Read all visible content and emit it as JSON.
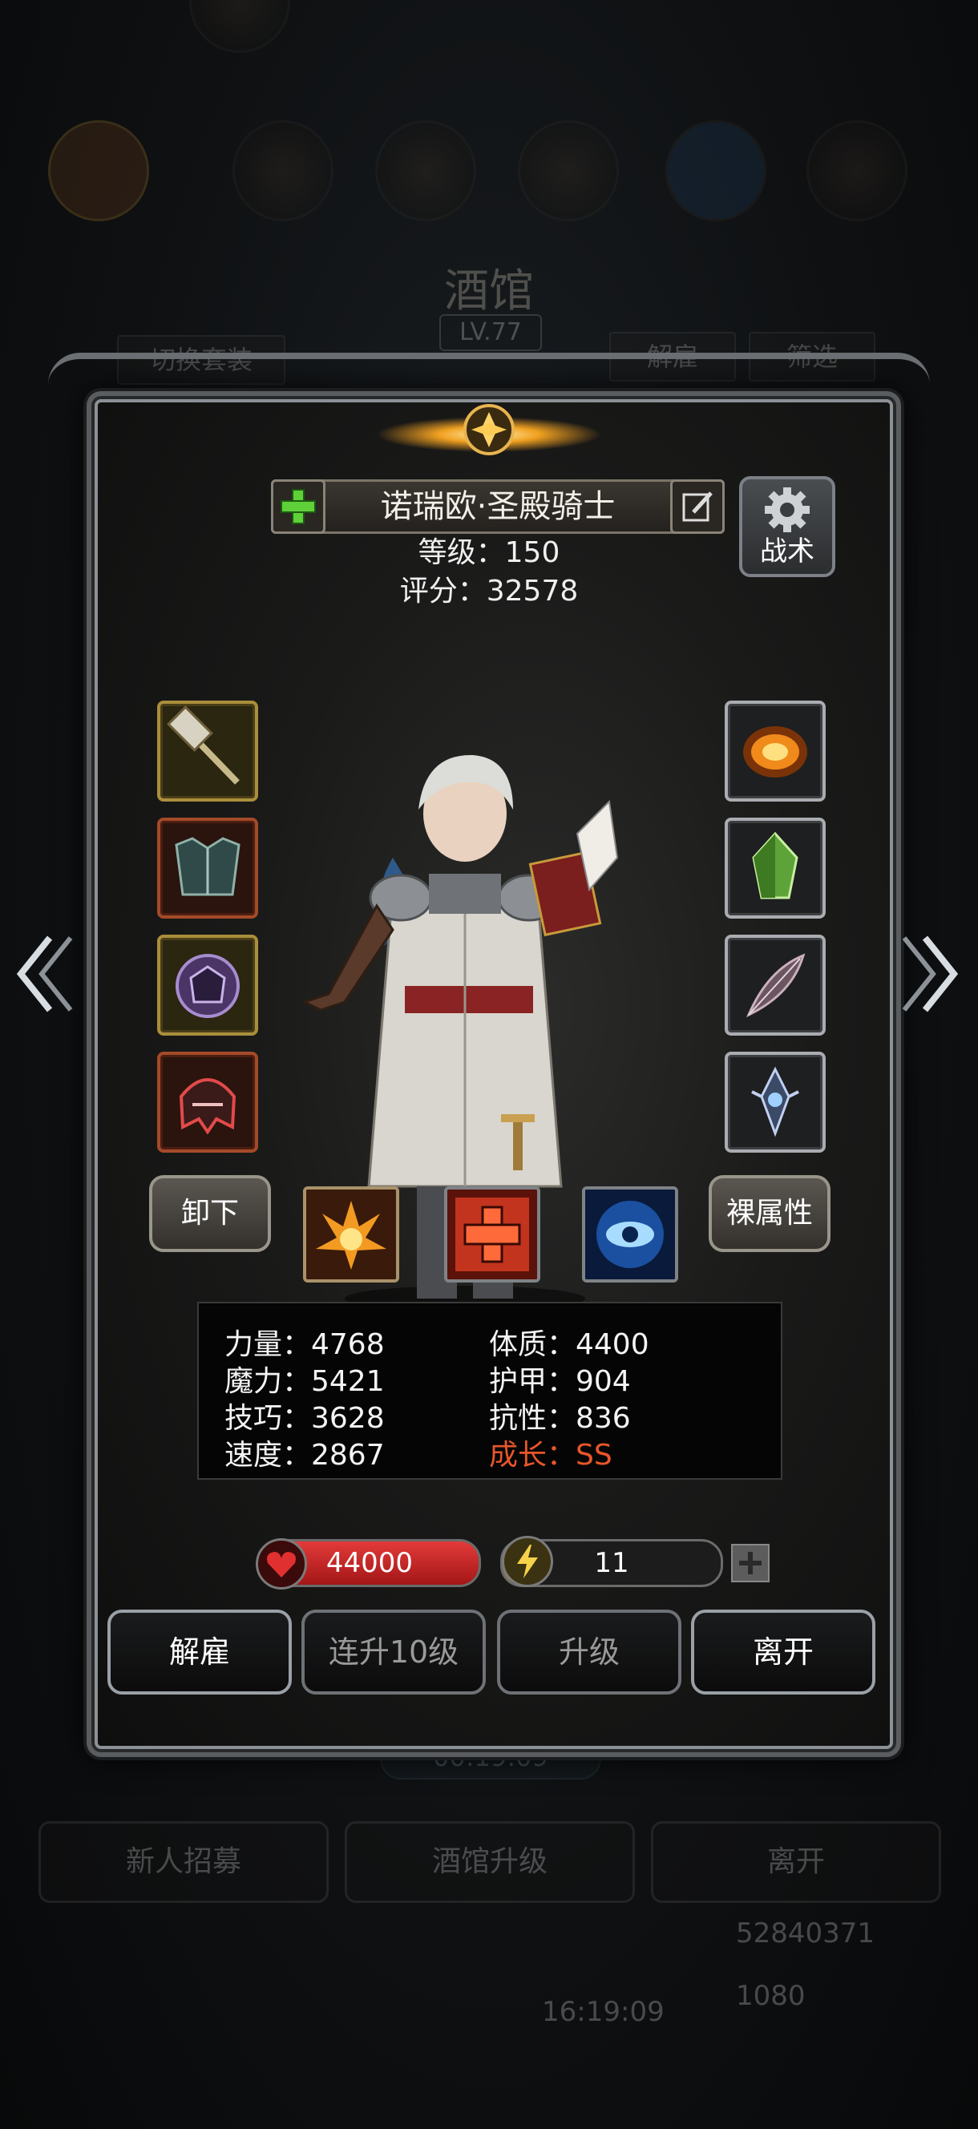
{
  "background": {
    "title": "酒馆",
    "level": "LV.77",
    "switch_outfit": "切换套装",
    "dismiss": "解雇",
    "filter": "筛选",
    "timer": "00:19:09",
    "recruit": "新人招募",
    "upgrade_tavern": "酒馆升级",
    "leave": "离开",
    "currency_gold": "52840371",
    "currency_gem": "1080",
    "clock": "16:19:09"
  },
  "hero": {
    "name": "诺瑞欧·圣殿骑士",
    "level_line": "等级：150",
    "score_line": "评分：32578",
    "tactic_label": "战术"
  },
  "buttons": {
    "unequip": "卸下",
    "bare_attr": "裸属性"
  },
  "stats": [
    {
      "label": "力量：4768",
      "highlight": false
    },
    {
      "label": "体质：4400",
      "highlight": false
    },
    {
      "label": "魔力：5421",
      "highlight": false
    },
    {
      "label": "护甲：904",
      "highlight": false
    },
    {
      "label": "技巧：3628",
      "highlight": false
    },
    {
      "label": "抗性：836",
      "highlight": false
    },
    {
      "label": "速度：2867",
      "highlight": false
    },
    {
      "label": "成长：SS",
      "highlight": true
    }
  ],
  "hp": {
    "value": "44000"
  },
  "energy": {
    "value": "11",
    "fill_fraction": 0.12
  },
  "actions": {
    "dismiss": "解雇",
    "level_up_10": "连升10级",
    "level_up": "升级",
    "leave": "离开"
  },
  "equipment_left": [
    "hammer-icon",
    "chest-armor-icon",
    "shield-icon",
    "helmet-icon"
  ],
  "equipment_right": [
    "flame-ring-icon",
    "green-crystal-icon",
    "feather-icon",
    "amulet-icon"
  ],
  "skills": [
    "fire-burst-icon",
    "red-cross-icon",
    "blue-eye-icon"
  ],
  "colors": {
    "growth": "#e8562a",
    "hp": "#d32a2a",
    "energy": "#e0b834"
  }
}
